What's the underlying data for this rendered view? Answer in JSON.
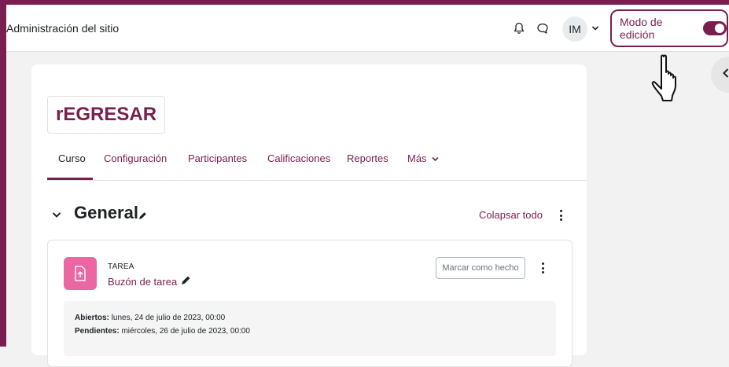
{
  "navbar": {
    "site_title": "Administración del sitio",
    "avatar_initials": "IM",
    "edit_mode_label": "Modo de edición",
    "edit_mode_on": true
  },
  "course": {
    "title": "rEGRESAR",
    "tabs": [
      {
        "label": "Curso",
        "active": true
      },
      {
        "label": "Configuración",
        "active": false
      },
      {
        "label": "Participantes",
        "active": false
      },
      {
        "label": "Calificaciones",
        "active": false
      },
      {
        "label": "Reportes",
        "active": false
      },
      {
        "label": "Más",
        "active": false
      }
    ]
  },
  "section": {
    "title": "General",
    "collapse_all": "Colapsar todo"
  },
  "activity": {
    "type": "TAREA",
    "name": "Buzón de tarea",
    "mark_done": "Marcar como hecho",
    "opened_label": "Abiertos:",
    "opened_value": "lunes, 24 de julio de 2023, 00:00",
    "due_label": "Pendientes:",
    "due_value": "miércoles, 26 de julio de 2023, 00:00"
  },
  "colors": {
    "brand": "#7a1e4f",
    "assignment_icon": "#eb66a2"
  },
  "icons": [
    "bell-icon",
    "chat-icon",
    "chevron-down-icon",
    "chevron-left-icon",
    "pencil-icon",
    "kebab-menu-icon",
    "upload-file-icon",
    "hand-pointer-cursor"
  ]
}
